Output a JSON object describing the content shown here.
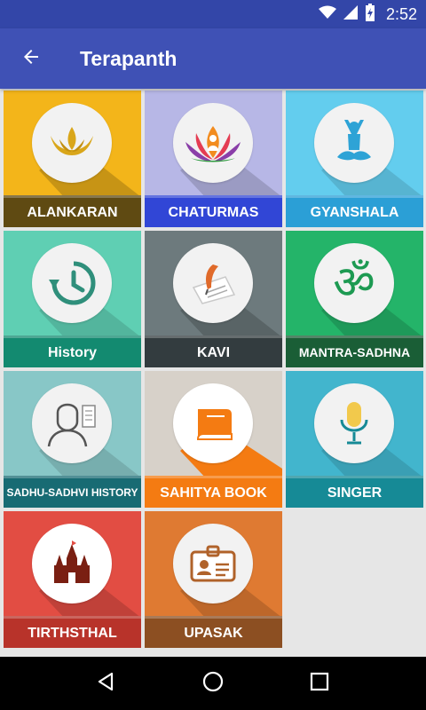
{
  "status_bar": {
    "time": "2:52",
    "icons": [
      "wifi-icon",
      "signal-icon",
      "battery-charging-icon"
    ]
  },
  "app_bar": {
    "title": "Terapanth",
    "back_icon": "arrow-back-icon"
  },
  "tiles": [
    {
      "label": "ALANKARAN",
      "icon": "diya-lamp-icon",
      "bg": "#f3b51a",
      "label_bg": "#5f4a12"
    },
    {
      "label": "CHATURMAS",
      "icon": "lotus-meditation-icon",
      "bg": "#b7b7e6",
      "label_bg": "#3146d6"
    },
    {
      "label": "GYANSHALA",
      "icon": "yoga-pose-icon",
      "bg": "#63cdee",
      "label_bg": "#2b9fd6"
    },
    {
      "label": "History",
      "icon": "history-clock-icon",
      "bg": "#5fcfb3",
      "label_bg": "#138a70"
    },
    {
      "label": "KAVI",
      "icon": "quill-paper-icon",
      "bg": "#6d7a7d",
      "label_bg": "#333c3f"
    },
    {
      "label": "MANTRA-SADHNA",
      "icon": "om-icon",
      "bg": "#24b469",
      "label_bg": "#1a5e36"
    },
    {
      "label": "SADHU-SADHVI HISTORY",
      "icon": "monk-portrait-icon",
      "bg": "#88c7c7",
      "label_bg": "#186b73"
    },
    {
      "label": "SAHITYA BOOK",
      "icon": "book-icon",
      "bg": "#d7d1c9",
      "label_bg": "#f47b12"
    },
    {
      "label": "SINGER",
      "icon": "microphone-icon",
      "bg": "#42b5cd",
      "label_bg": "#168a96"
    },
    {
      "label": "TIRTHSTHAL",
      "icon": "temple-icon",
      "bg": "#e24d43",
      "label_bg": "#b8332a"
    },
    {
      "label": "UPASAK",
      "icon": "id-card-icon",
      "bg": "#df7a32",
      "label_bg": "#8c4f22"
    }
  ],
  "nav_bar": {
    "back": "nav-back-icon",
    "home": "nav-home-icon",
    "recents": "nav-recents-icon"
  }
}
